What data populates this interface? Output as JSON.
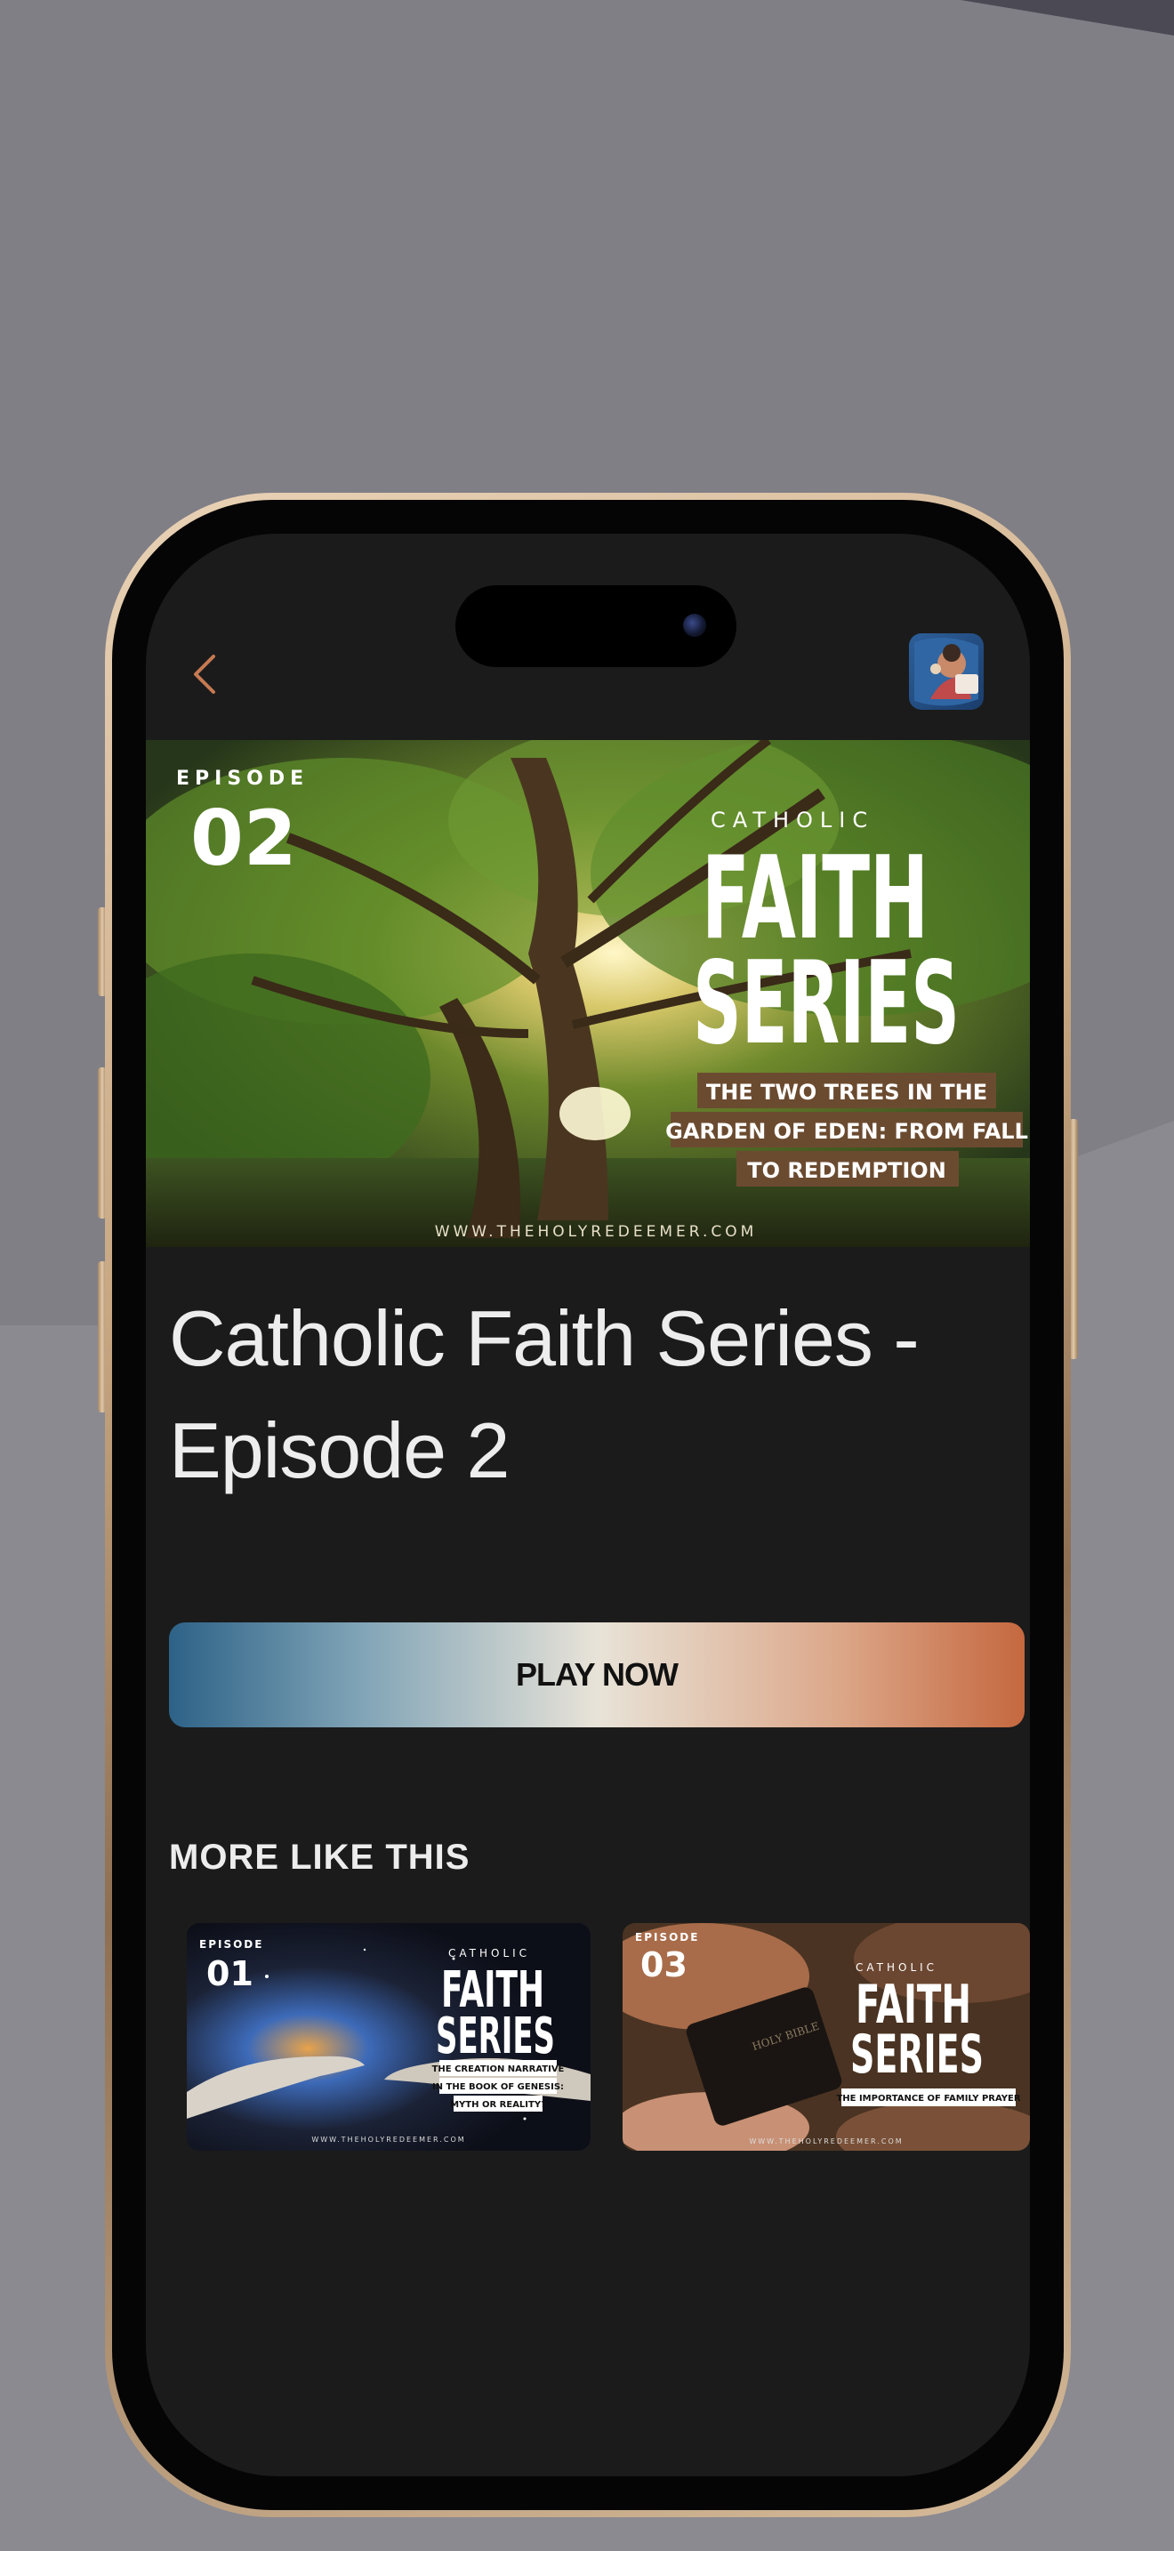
{
  "header": {
    "back_icon": "chevron-left-icon",
    "app_logo_icon": "app-logo-icon"
  },
  "colors": {
    "accent_orange": "#c67a52",
    "screen_bg": "#1b1b1b",
    "play_gradient": [
      "#2d6287",
      "#e8e3d8",
      "#c5683f"
    ]
  },
  "hero": {
    "episode_word": "EPISODE",
    "episode_number": "02",
    "series_small": "CATHOLIC",
    "series_big_line1": "FAITH",
    "series_big_line2": "SERIES",
    "subtitle_line1": "THE TWO TREES IN THE",
    "subtitle_line2": "GARDEN OF EDEN: FROM FALL",
    "subtitle_line3": "TO REDEMPTION",
    "website": "WWW.THEHOLYREDEEMER.COM"
  },
  "title_line1": "Catholic Faith Series -",
  "title_line2": "Episode 2",
  "play_label": "PLAY NOW",
  "more_heading": "MORE LIKE THIS",
  "more": [
    {
      "episode_word": "EPISODE",
      "episode_number": "01",
      "series_small": "CATHOLIC",
      "series_big_line1": "FAITH",
      "series_big_line2": "SERIES",
      "subtitle_line1": "THE CREATION NARRATIVE",
      "subtitle_line2": "IN THE BOOK OF GENESIS:",
      "subtitle_line3": "MYTH OR REALITY?",
      "website": "WWW.THEHOLYREDEEMER.COM"
    },
    {
      "episode_word": "EPISODE",
      "episode_number": "03",
      "series_small": "CATHOLIC",
      "series_big_line1": "FAITH",
      "series_big_line2": "SERIES",
      "subtitle_line1": "THE IMPORTANCE OF FAMILY PRAYER",
      "book_text": "HOLY BIBLE",
      "website": "WWW.THEHOLYREDEEMER.COM"
    }
  ]
}
